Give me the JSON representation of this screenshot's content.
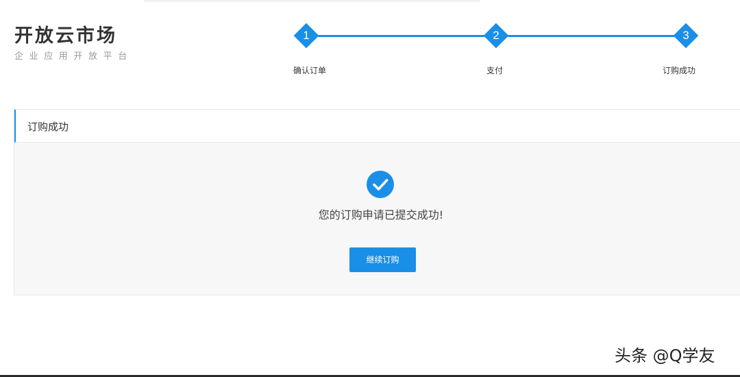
{
  "brand": {
    "name": "开放云市场",
    "tagline": "企业应用开放平台"
  },
  "steps": [
    {
      "number": "1",
      "label": "确认订单"
    },
    {
      "number": "2",
      "label": "支付"
    },
    {
      "number": "3",
      "label": "订购成功"
    }
  ],
  "current_step": 3,
  "panel": {
    "title": "订购成功",
    "message": "您的订购申请已提交成功!",
    "button_label": "继续订购",
    "status_icon": "check-circle-icon"
  },
  "colors": {
    "accent": "#1a8fe8",
    "panel_bg": "#f7f7f7",
    "text": "#333333",
    "subtext": "#999999"
  },
  "watermark": "头条 @Q学友"
}
